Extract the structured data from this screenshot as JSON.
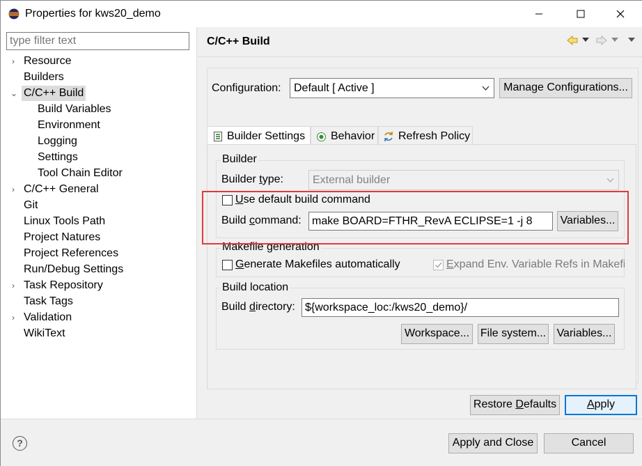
{
  "window": {
    "title": "Properties for kws20_demo",
    "minimize": "—",
    "maximize": "☐",
    "close": "✕"
  },
  "filter": {
    "placeholder": "type filter text"
  },
  "tree": {
    "items": [
      {
        "label": "Resource"
      },
      {
        "label": "Builders"
      },
      {
        "label": "C/C++ Build"
      },
      {
        "label": "Build Variables"
      },
      {
        "label": "Environment"
      },
      {
        "label": "Logging"
      },
      {
        "label": "Settings"
      },
      {
        "label": "Tool Chain Editor"
      },
      {
        "label": "C/C++ General"
      },
      {
        "label": "Git"
      },
      {
        "label": "Linux Tools Path"
      },
      {
        "label": "Project Natures"
      },
      {
        "label": "Project References"
      },
      {
        "label": "Run/Debug Settings"
      },
      {
        "label": "Task Repository"
      },
      {
        "label": "Task Tags"
      },
      {
        "label": "Validation"
      },
      {
        "label": "WikiText"
      }
    ]
  },
  "page": {
    "title": "C/C++ Build",
    "configuration_label": "Configuration:",
    "configuration_value": "Default  [ Active ]",
    "manage_button": "Manage Configurations...",
    "tabs": [
      {
        "label": "Builder Settings"
      },
      {
        "label": "Behavior"
      },
      {
        "label": "Refresh Policy"
      }
    ],
    "builder": {
      "group_label": "Builder",
      "type_label_pre": "Builder ",
      "type_label_u": "t",
      "type_label_post": "ype:",
      "type_value": "External builder",
      "default_cmd_u": "U",
      "default_cmd_post": "se default build command",
      "cmd_label_pre": "Build ",
      "cmd_label_u": "c",
      "cmd_label_post": "ommand:",
      "cmd_value": "make BOARD=FTHR_RevA ECLIPSE=1 -j 8",
      "variables_button": "Variables..."
    },
    "makefile": {
      "group_label": "Makefile generation",
      "generate_u": "G",
      "generate_post": "enerate Makefiles automatically",
      "expand_u": "E",
      "expand_post": "xpand Env. Variable Refs in Makefil"
    },
    "location": {
      "group_label": "Build location",
      "dir_label_pre": "Build ",
      "dir_label_u": "d",
      "dir_label_post": "irectory:",
      "dir_value": "${workspace_loc:/kws20_demo}/",
      "workspace_button": "Workspace...",
      "filesystem_button": "File system...",
      "variables_button": "Variables..."
    },
    "restore_pre": "Restore ",
    "restore_u": "D",
    "restore_post": "efaults",
    "apply_u": "A",
    "apply_post": "pply"
  },
  "footer": {
    "help": "?",
    "apply_close": "Apply and Close",
    "cancel": "Cancel"
  },
  "colors": {
    "highlight": "#e0393e",
    "accent": "#0078d7"
  }
}
